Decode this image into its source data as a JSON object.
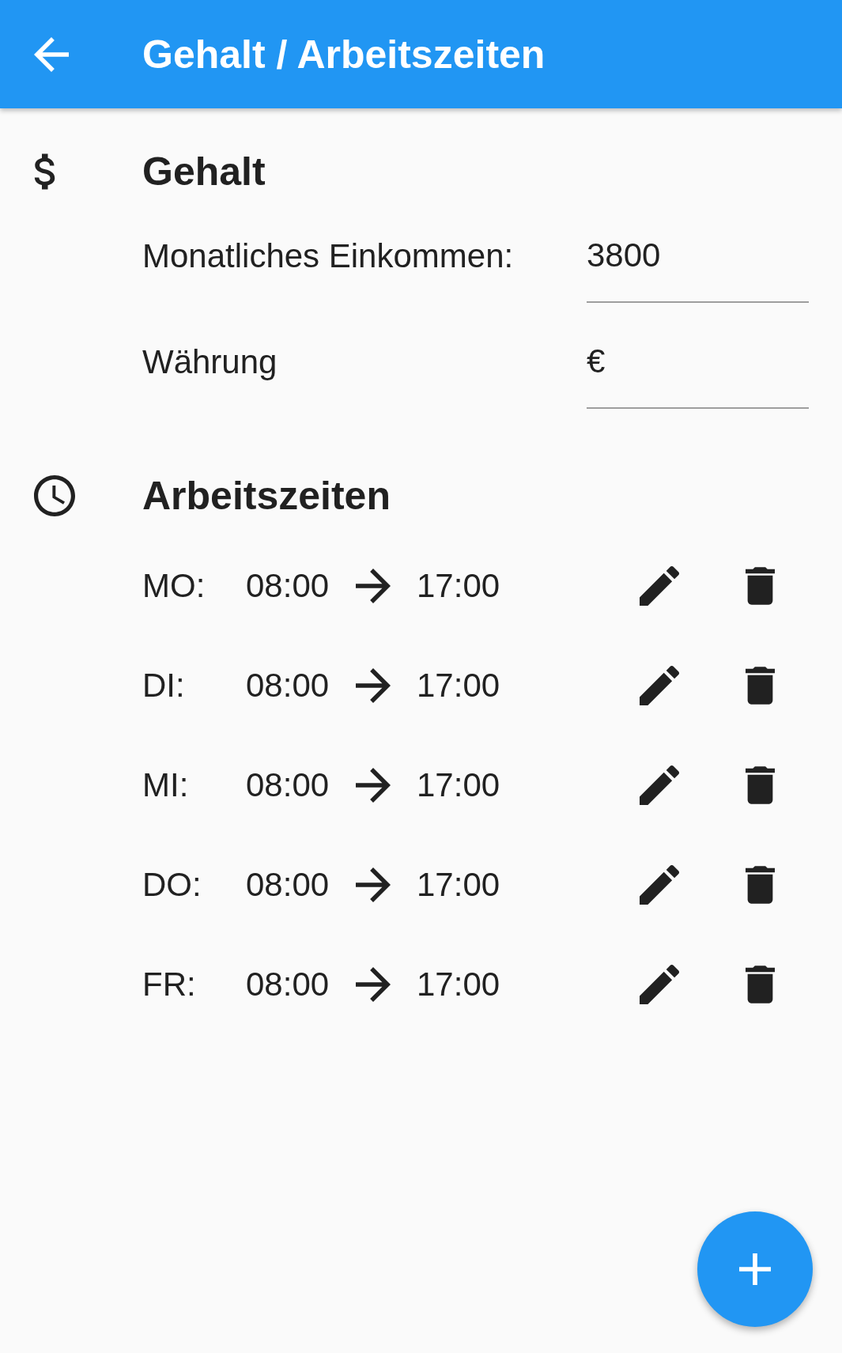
{
  "app_bar": {
    "title": "Gehalt / Arbeitszeiten"
  },
  "salary": {
    "heading": "Gehalt",
    "fields": [
      {
        "label": "Monatliches Einkommen:",
        "value": "3800"
      },
      {
        "label": "Währung",
        "value": "€"
      }
    ]
  },
  "working_hours": {
    "heading": "Arbeitszeiten",
    "rows": [
      {
        "day": "MO:",
        "start": "08:00",
        "end": "17:00"
      },
      {
        "day": "DI:",
        "start": "08:00",
        "end": "17:00"
      },
      {
        "day": "MI:",
        "start": "08:00",
        "end": "17:00"
      },
      {
        "day": "DO:",
        "start": "08:00",
        "end": "17:00"
      },
      {
        "day": "FR:",
        "start": "08:00",
        "end": "17:00"
      }
    ]
  }
}
